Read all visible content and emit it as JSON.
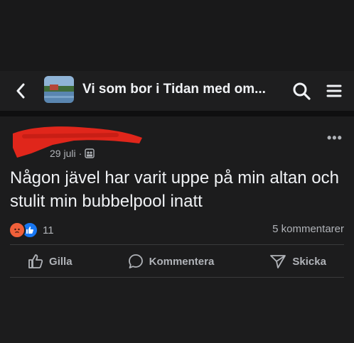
{
  "header": {
    "title": "Vi som bor i Tidan med om...",
    "back_icon": "chevron-left-icon",
    "search_icon": "search-icon",
    "menu_icon": "menu-icon"
  },
  "post": {
    "date": "29 juli",
    "separator": "·",
    "audience_icon": "group-icon",
    "text": "Någon jävel har varit uppe på min altan och stulit min bubbelpool inatt",
    "reaction_count": "11",
    "reaction_icons": [
      "angry-reaction-icon",
      "like-reaction-icon"
    ],
    "comments": "5 kommentarer"
  },
  "actions": {
    "like": "Gilla",
    "comment": "Kommentera",
    "share": "Skicka"
  },
  "colors": {
    "background": "#19191a",
    "redaction": "#e0261b",
    "like_blue": "#1877f2",
    "angry": "#f0603a"
  }
}
